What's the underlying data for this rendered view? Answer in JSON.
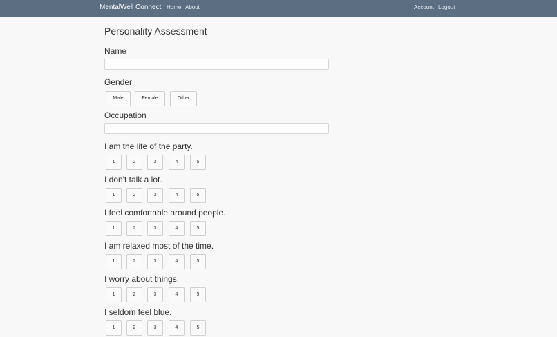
{
  "navbar": {
    "brand": "MentalWell Connect",
    "links": [
      "Home",
      "About"
    ],
    "right_links": [
      "Account",
      "Logout"
    ]
  },
  "page": {
    "title": "Personality Assessment",
    "name_label": "Name",
    "name_value": "",
    "gender_label": "Gender",
    "gender_options": [
      "Male",
      "Female",
      "Other"
    ],
    "occupation_label": "Occupation",
    "occupation_value": ""
  },
  "questions": [
    {
      "text": "I am the life of the party.",
      "options": [
        "1",
        "2",
        "3",
        "4",
        "5"
      ]
    },
    {
      "text": "I don't talk a lot.",
      "options": [
        "1",
        "2",
        "3",
        "4",
        "5"
      ]
    },
    {
      "text": "I feel comfortable around people.",
      "options": [
        "1",
        "2",
        "3",
        "4",
        "5"
      ]
    },
    {
      "text": "I am relaxed most of the time.",
      "options": [
        "1",
        "2",
        "3",
        "4",
        "5"
      ]
    },
    {
      "text": "I worry about things.",
      "options": [
        "1",
        "2",
        "3",
        "4",
        "5"
      ]
    },
    {
      "text": "I seldom feel blue.",
      "options": [
        "1",
        "2",
        "3",
        "4",
        "5"
      ]
    }
  ]
}
